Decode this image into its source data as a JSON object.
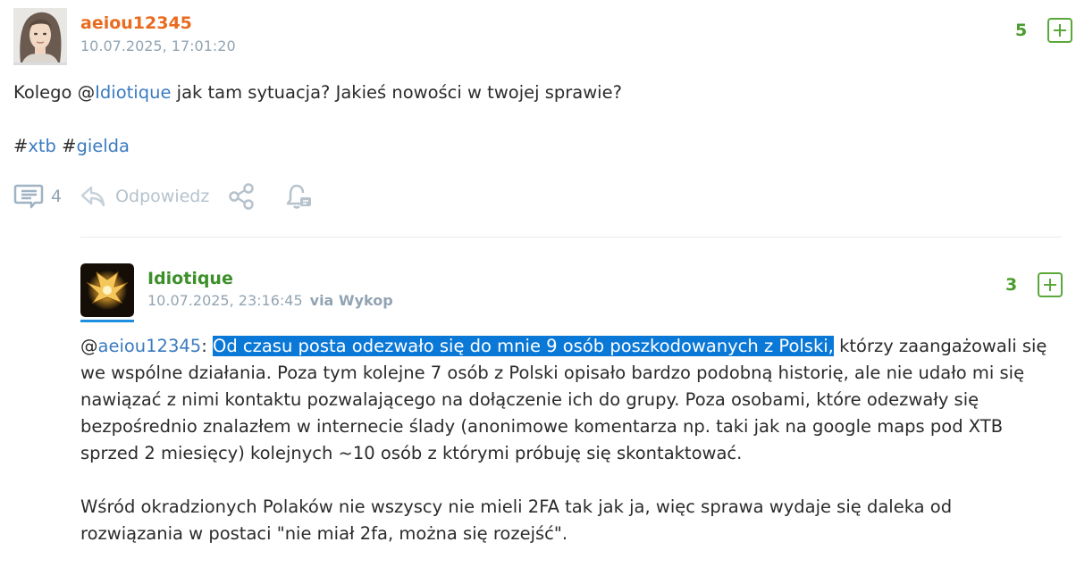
{
  "post": {
    "author": "aeiou12345",
    "date": "10.07.2025, 17:01:20",
    "votes": "5",
    "text_prefix": "Kolego @",
    "mention": "Idiotique",
    "text_suffix": " jak tam sytuacja? Jakieś nowości w twojej sprawie?",
    "tags": [
      "xtb",
      "gielda"
    ],
    "comments_count": "4",
    "reply_label": "Odpowiedz",
    "icons": [
      "comments-icon",
      "reply-icon",
      "share-icon",
      "notification-bell-icon",
      "upvote-plus-icon"
    ],
    "author_color": "#e86b1f"
  },
  "reply": {
    "author": "Idiotique",
    "date": "10.07.2025, 23:16:45",
    "via_label": "via Wykop",
    "votes": "3",
    "mention_prefix": "@",
    "mention": "aeiou12345",
    "colon": ":",
    "highlighted": "Od czasu posta odezwało się do mnie 9 osób poszkodowanych z Polski,",
    "line1_rest": " którzy zaangażowali się",
    "line2": "we wspólne działania. Poza tym kolejne 7 osób z Polski opisało bardzo podobną historię, ale nie udało mi się",
    "line3": "nawiązać z nimi kontaktu pozwalającego na dołączenie ich do grupy. Poza osobami, które odezwały się",
    "line4": "bezpośrednio znalazłem w internecie ślady (anonimowe komentarza np. taki jak na google maps pod XTB",
    "line5": "sprzed 2 miesięcy) kolejnych ~10 osób z którymi próbuję się skontaktować.",
    "para2_line1": "Wśród okradzionych Polaków nie wszyscy nie mieli 2FA tak jak ja, więc sprawa wydaje się daleka od",
    "para2_line2": "rozwiązania w postaci \"nie miał 2fa, można się rozejść\".",
    "author_color": "#3d8f2a",
    "highlight_color": "#0a78d7"
  }
}
